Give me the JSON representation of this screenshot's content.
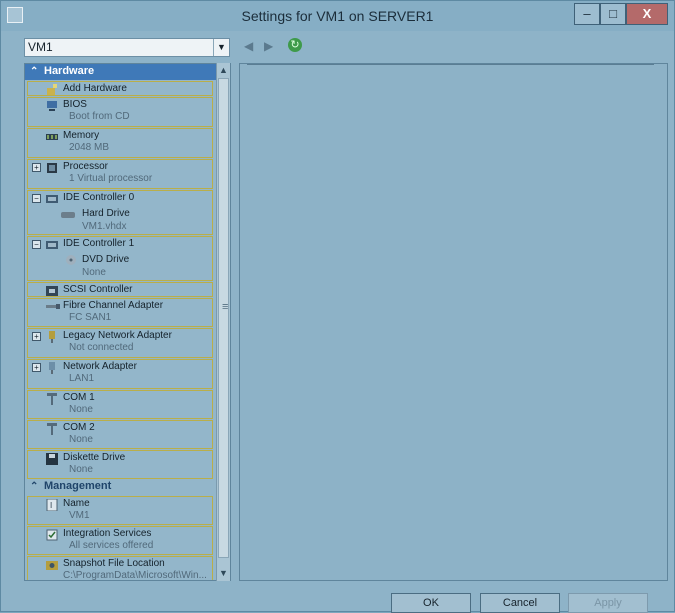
{
  "window": {
    "title": "Settings for VM1 on SERVER1",
    "minimize_label": "–",
    "maximize_label": "□",
    "close_label": "X"
  },
  "toolbar": {
    "vm_select_value": "VM1",
    "back_icon": "back-arrow-icon",
    "forward_icon": "forward-arrow-icon",
    "refresh_icon": "refresh-icon"
  },
  "sidebar": {
    "hardware_header": "Hardware",
    "management_header": "Management",
    "items": [
      {
        "label": "Add Hardware",
        "sub": "",
        "icon": "add-hardware-icon"
      },
      {
        "label": "BIOS",
        "sub": "Boot from CD",
        "icon": "bios-icon"
      },
      {
        "label": "Memory",
        "sub": "2048 MB",
        "icon": "memory-icon"
      },
      {
        "label": "Processor",
        "sub": "1 Virtual processor",
        "icon": "processor-icon"
      },
      {
        "label": "IDE Controller 0",
        "sub": "",
        "icon": "ide-controller-icon"
      },
      {
        "label": "Hard Drive",
        "sub": "VM1.vhdx",
        "icon": "hard-drive-icon"
      },
      {
        "label": "IDE Controller 1",
        "sub": "",
        "icon": "ide-controller-icon"
      },
      {
        "label": "DVD Drive",
        "sub": "None",
        "icon": "dvd-drive-icon"
      },
      {
        "label": "SCSI Controller",
        "sub": "",
        "icon": "scsi-controller-icon"
      },
      {
        "label": "Fibre Channel Adapter",
        "sub": "FC SAN1",
        "icon": "fibre-channel-icon"
      },
      {
        "label": "Legacy Network Adapter",
        "sub": "Not connected",
        "icon": "network-adapter-icon"
      },
      {
        "label": "Network Adapter",
        "sub": "LAN1",
        "icon": "network-adapter-icon"
      },
      {
        "label": "COM 1",
        "sub": "None",
        "icon": "com-port-icon"
      },
      {
        "label": "COM 2",
        "sub": "None",
        "icon": "com-port-icon"
      },
      {
        "label": "Diskette Drive",
        "sub": "None",
        "icon": "diskette-drive-icon"
      },
      {
        "label": "Name",
        "sub": "VM1",
        "icon": "name-icon"
      },
      {
        "label": "Integration Services",
        "sub": "All services offered",
        "icon": "integration-services-icon"
      },
      {
        "label": "Snapshot File Location",
        "sub": "C:\\ProgramData\\Microsoft\\Win...",
        "icon": "snapshot-location-icon"
      }
    ]
  },
  "buttons": {
    "ok": "OK",
    "cancel": "Cancel",
    "apply": "Apply"
  }
}
